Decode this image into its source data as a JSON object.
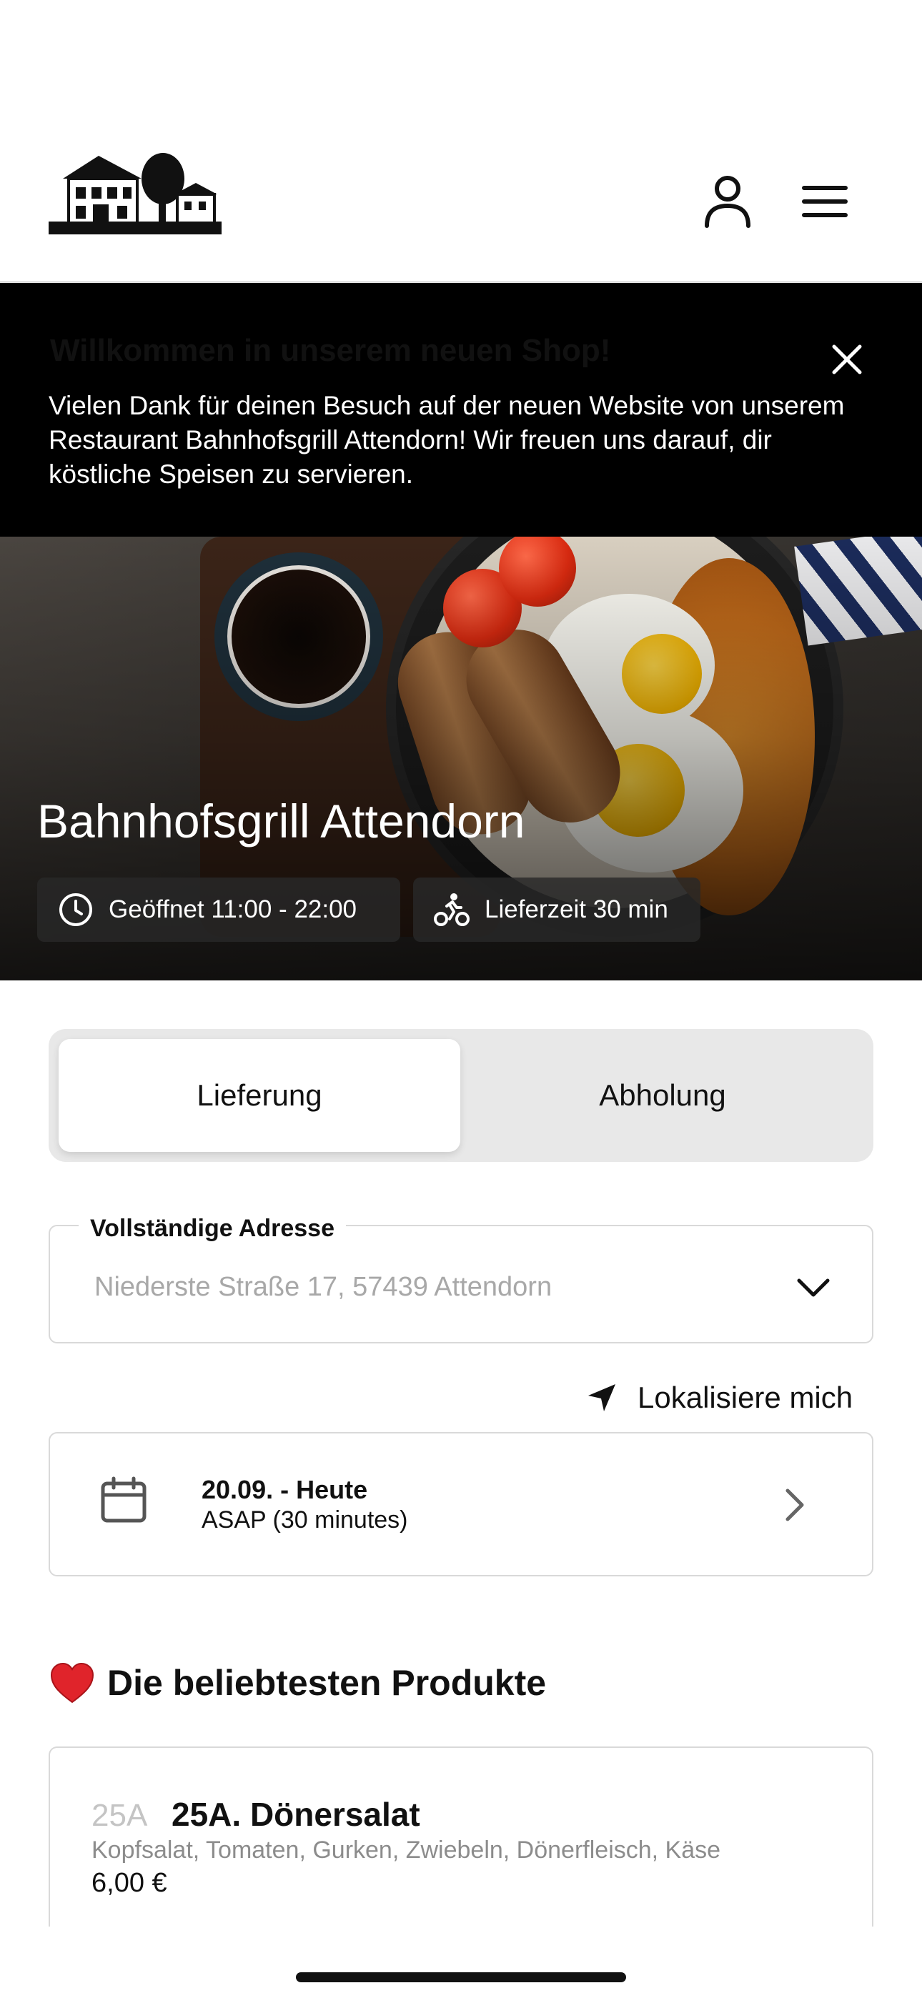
{
  "header": {
    "logo_icon": "restaurant-house-logo",
    "account_icon": "user-icon",
    "menu_icon": "hamburger-menu-icon"
  },
  "banner": {
    "title": "Willkommen in unserem neuen Shop!",
    "text": "Vielen Dank für deinen Besuch auf der neuen Website von unserem Restaurant Bahnhofsgrill Attendorn! Wir freuen uns darauf, dir köstliche Speisen zu servieren.",
    "close_icon": "close-icon"
  },
  "hero": {
    "title": "Bahnhofsgrill Attendorn",
    "opening_hours": "Geöffnet 11:00 - 22:00",
    "delivery_time": "Lieferzeit 30 min"
  },
  "order_mode": {
    "options": [
      "Lieferung",
      "Abholung"
    ],
    "selected": "Lieferung"
  },
  "address": {
    "label": "Vollständige Adresse",
    "placeholder": "Niederste Straße 17, 57439 Attendorn"
  },
  "locate": {
    "label": "Lokalisiere mich",
    "icon": "location-arrow-icon"
  },
  "schedule": {
    "date": "20.09. - Heute",
    "time": "ASAP (30 minutes)"
  },
  "popular": {
    "title": "Die beliebtesten Produkte",
    "products": [
      {
        "code": "25A",
        "name": "25A. Dönersalat",
        "description": "Kopfsalat, Tomaten, Gurken, Zwiebeln, Dönerfleisch, Käse",
        "price": "6,00 €"
      }
    ]
  },
  "colors": {
    "banner_bg": "#000000",
    "segment_bg": "#e8e8e8",
    "border": "#d9d9d9",
    "muted_text": "#8c8c8c"
  }
}
